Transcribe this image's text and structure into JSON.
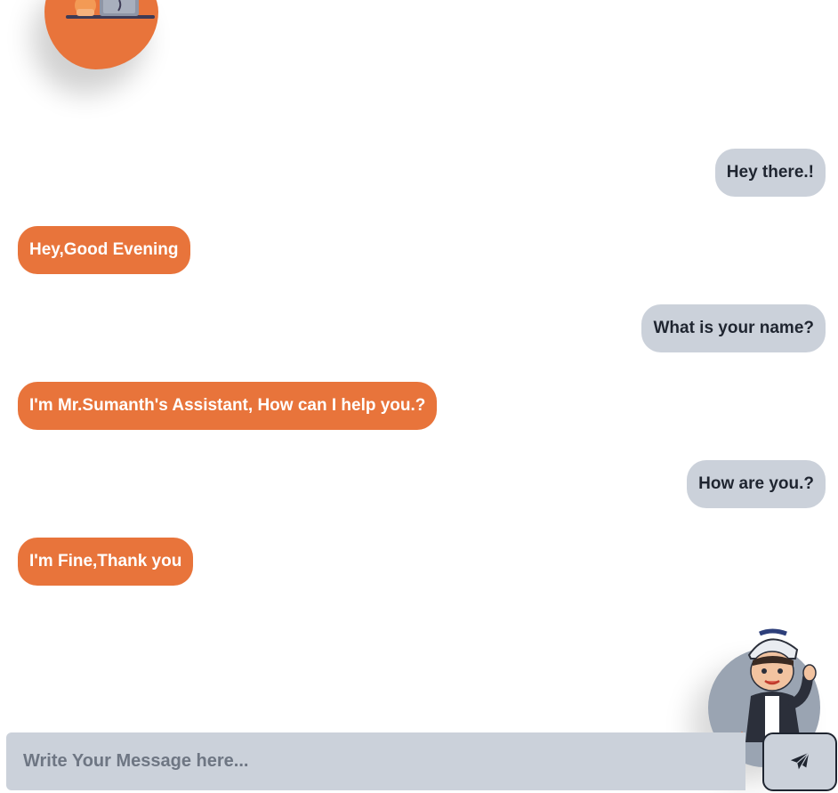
{
  "colors": {
    "accent": "#e8743b",
    "user_bubble": "#cbd1da",
    "user_text": "#1f2530",
    "bot_text": "#ffffff",
    "input_bg": "#cbd1da",
    "user_avatar_bg": "#9aa4b2"
  },
  "avatars": {
    "bot": "bot-illustration-icon",
    "user": "waving-boy-illustration-icon"
  },
  "messages": [
    {
      "sender": "user",
      "text": "Hey there.!"
    },
    {
      "sender": "bot",
      "text": "Hey,Good Evening"
    },
    {
      "sender": "user",
      "text": "What is your name?"
    },
    {
      "sender": "bot",
      "text": "I'm Mr.Sumanth's Assistant, How can I help you.?"
    },
    {
      "sender": "user",
      "text": "How are you.?"
    },
    {
      "sender": "bot",
      "text": "I'm Fine,Thank you"
    }
  ],
  "composer": {
    "placeholder": "Write Your Message here...",
    "value": "",
    "send_icon": "paper-plane-icon"
  }
}
